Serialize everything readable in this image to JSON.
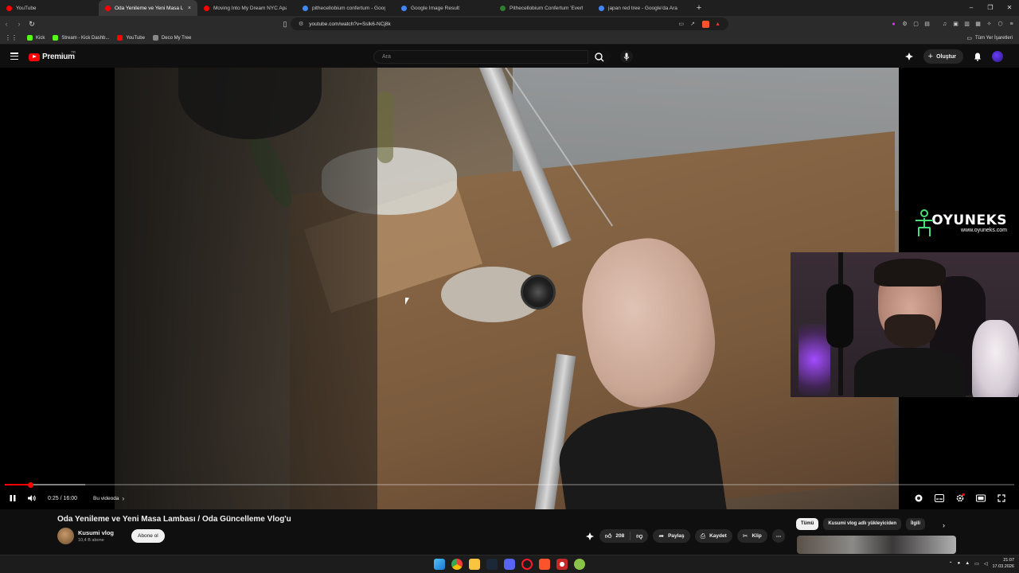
{
  "browser": {
    "tabs": [
      {
        "label": "YouTube",
        "favicon_color": "#ff0000",
        "active": false
      },
      {
        "label": "Oda Yenileme ve Yeni Masa L",
        "favicon_color": "#ff0000",
        "active": true
      },
      {
        "label": "Moving Into My Dream NYC Apartm",
        "favicon_color": "#ff0000",
        "active": false
      },
      {
        "label": "pithecellobium confertum - Google",
        "favicon_color": "#4285f4",
        "active": false
      },
      {
        "label": "Google Image Result",
        "favicon_color": "#4285f4",
        "active": false
      },
      {
        "label": "Pithecellobium Confertum 'Everfres",
        "favicon_color": "#2e7d32",
        "active": false
      },
      {
        "label": "japan red tree - Google'da Ara",
        "favicon_color": "#4285f4",
        "active": false
      }
    ],
    "new_tab_glyph": "+",
    "tab_close_glyph": "×",
    "url": "youtube.com/watch?v=Sslk6-NCj8k",
    "bookmarks": [
      {
        "label": "Kick",
        "color": "#53fc18"
      },
      {
        "label": "Stream - Kick Dashb...",
        "color": "#53fc18"
      },
      {
        "label": "YouTube",
        "color": "#ff0000"
      },
      {
        "label": "Deco My Tree",
        "color": "#888888"
      }
    ],
    "all_bookmarks_label": "Tüm Yer İşaretleri"
  },
  "youtube": {
    "logo_text": "Premium",
    "region": "TR",
    "search_placeholder": "Ara",
    "create_label": "Oluştur",
    "accent": "#ff0000"
  },
  "video": {
    "sponsor_name": "OYUNEKS",
    "sponsor_url": "www.oyuneks.com",
    "time": "0:25 / 16:00",
    "chapter": "Bu videoda",
    "progress_fraction": 0.026,
    "buffered_fraction": 0.08
  },
  "meta": {
    "title": "Oda Yenileme ve Yeni Masa Lambası / Oda Güncelleme Vlog'u",
    "channel_name": "Kusumi vlog",
    "subscribers": "10,4 B abone",
    "subscribe_label": "Abone ol",
    "like_count": "208",
    "share_label": "Paylaş",
    "save_label": "Kaydet",
    "clip_label": "Klip"
  },
  "related_chips": [
    {
      "label": "Tümü",
      "active": true
    },
    {
      "label": "Kusumi vlog adlı yükleyiciden",
      "active": false
    },
    {
      "label": "İlgili",
      "active": false
    }
  ],
  "taskbar": {
    "time": "21:07",
    "date": "17.03.2026",
    "lang": "TR"
  }
}
